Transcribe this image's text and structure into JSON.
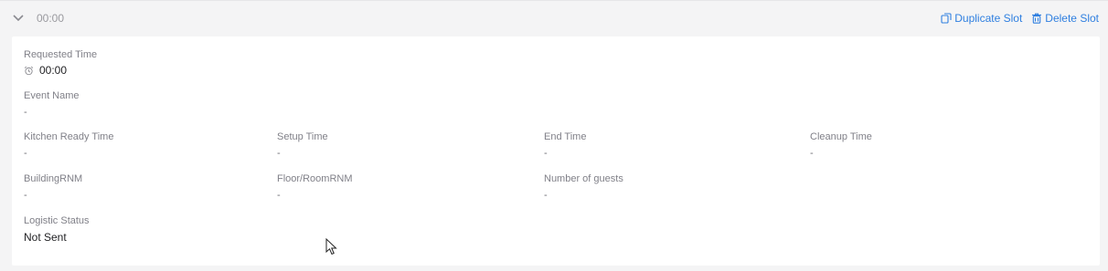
{
  "header": {
    "slot_time": "00:00",
    "duplicate_label": "Duplicate Slot",
    "delete_label": "Delete Slot"
  },
  "fields": {
    "requested_time": {
      "label": "Requested Time",
      "value": "00:00"
    },
    "event_name": {
      "label": "Event Name",
      "value": "-"
    },
    "kitchen_ready_time": {
      "label": "Kitchen Ready Time",
      "value": "-"
    },
    "setup_time": {
      "label": "Setup Time",
      "value": "-"
    },
    "end_time": {
      "label": "End Time",
      "value": "-"
    },
    "cleanup_time": {
      "label": "Cleanup Time",
      "value": "-"
    },
    "building": {
      "label": "BuildingRNM",
      "value": "-"
    },
    "floor_room": {
      "label": "Floor/RoomRNM",
      "value": "-"
    },
    "number_of_guests": {
      "label": "Number of guests",
      "value": "-"
    },
    "logistic_status": {
      "label": "Logistic Status",
      "value": "Not Sent"
    }
  },
  "colors": {
    "accent": "#2f7fe0",
    "background": "#f4f4f5",
    "card": "#ffffff"
  },
  "icons": {
    "collapse": "chevron-down-icon",
    "duplicate": "copy-icon",
    "delete": "trash-icon",
    "clock": "alarm-clock-icon"
  }
}
